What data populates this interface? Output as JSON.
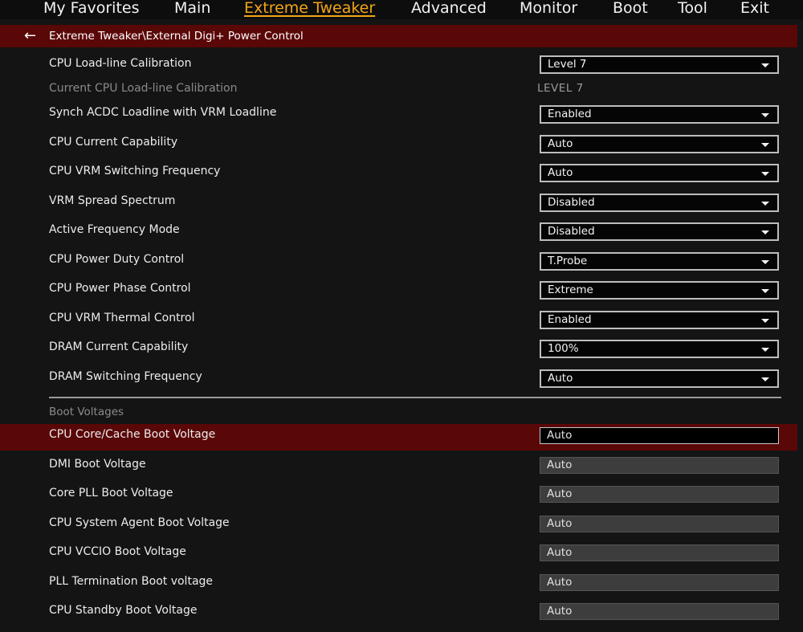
{
  "nav": {
    "tabs": [
      {
        "label": "My Favorites"
      },
      {
        "label": "Main"
      },
      {
        "label": "Extreme Tweaker"
      },
      {
        "label": "Advanced"
      },
      {
        "label": "Monitor"
      },
      {
        "label": "Boot"
      },
      {
        "label": "Tool"
      },
      {
        "label": "Exit"
      }
    ],
    "active_tab": "Extreme Tweaker"
  },
  "breadcrumb": "Extreme Tweaker\\External Digi+ Power Control",
  "settings": [
    {
      "label": "CPU Load-line Calibration",
      "value": "Level 7"
    },
    {
      "label": "Current CPU Load-line Calibration",
      "value": "LEVEL 7"
    },
    {
      "label": "Synch ACDC Loadline with VRM Loadline",
      "value": "Enabled"
    },
    {
      "label": "CPU Current Capability",
      "value": "Auto"
    },
    {
      "label": "CPU VRM Switching Frequency",
      "value": "Auto"
    },
    {
      "label": "VRM Spread Spectrum",
      "value": "Disabled"
    },
    {
      "label": "Active Frequency Mode",
      "value": "Disabled"
    },
    {
      "label": "CPU Power Duty Control",
      "value": "T.Probe"
    },
    {
      "label": "CPU Power Phase Control",
      "value": "Extreme"
    },
    {
      "label": "CPU VRM Thermal Control",
      "value": "Enabled"
    },
    {
      "label": "DRAM Current Capability",
      "value": "100%"
    },
    {
      "label": "DRAM Switching Frequency",
      "value": "Auto"
    }
  ],
  "boot_voltages": {
    "header": "Boot Voltages",
    "items": [
      {
        "label": "CPU Core/Cache Boot Voltage",
        "value": "Auto"
      },
      {
        "label": "DMI Boot Voltage",
        "value": "Auto"
      },
      {
        "label": "Core PLL Boot Voltage",
        "value": "Auto"
      },
      {
        "label": "CPU System Agent Boot Voltage",
        "value": "Auto"
      },
      {
        "label": "CPU VCCIO Boot Voltage",
        "value": "Auto"
      },
      {
        "label": "PLL Termination Boot voltage",
        "value": "Auto"
      },
      {
        "label": "CPU Standby Boot Voltage",
        "value": "Auto"
      }
    ]
  },
  "icons": {
    "back": "back-arrow-icon",
    "dropdown": "chevron-down-icon"
  },
  "colors": {
    "active_tab": "#f2a516",
    "selection_bar": "#5a0707",
    "background": "#141414"
  }
}
